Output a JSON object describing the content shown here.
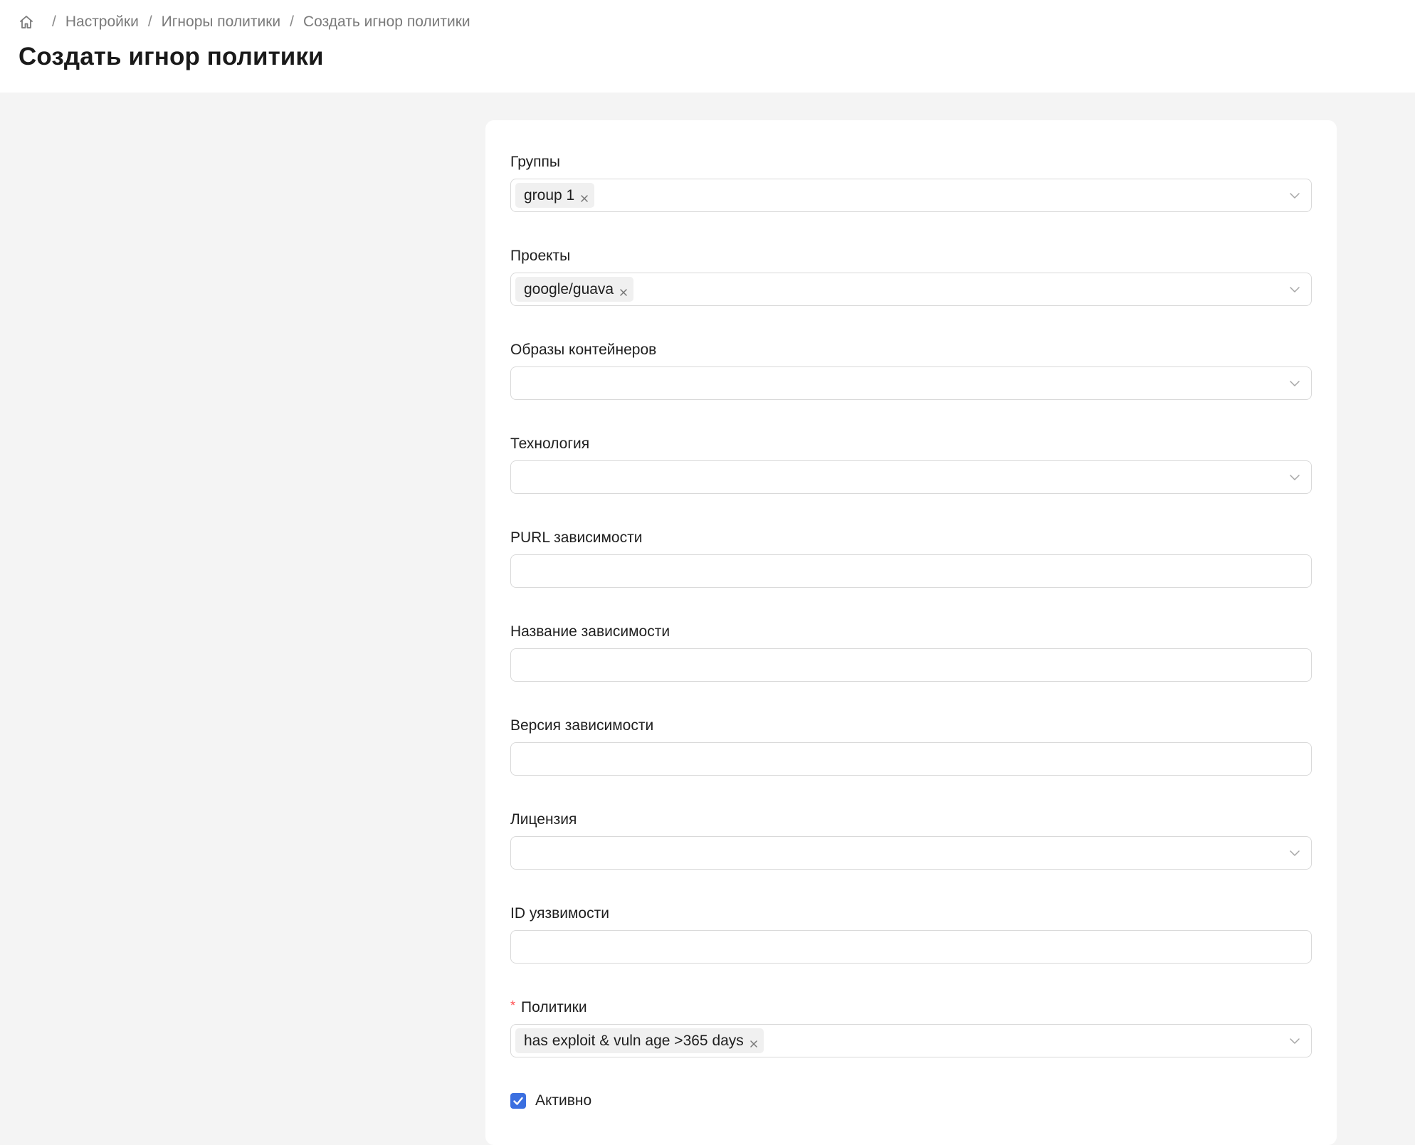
{
  "breadcrumb": {
    "home_icon": "home-icon",
    "items": [
      "Настройки",
      "Игноры политики",
      "Создать игнор политики"
    ]
  },
  "page_title": "Создать игнор политики",
  "form": {
    "groups": {
      "label": "Группы",
      "selected": [
        "group 1"
      ]
    },
    "projects": {
      "label": "Проекты",
      "selected": [
        "google/guava"
      ]
    },
    "container_images": {
      "label": "Образы контейнеров",
      "selected": []
    },
    "technology": {
      "label": "Технология",
      "selected": []
    },
    "dependency_purl": {
      "label": "PURL зависимости",
      "value": ""
    },
    "dependency_name": {
      "label": "Название зависимости",
      "value": ""
    },
    "dependency_version": {
      "label": "Версия зависимости",
      "value": ""
    },
    "license": {
      "label": "Лицензия",
      "selected": []
    },
    "vulnerability_id": {
      "label": "ID уязвимости",
      "value": ""
    },
    "policies": {
      "label": "Политики",
      "required": true,
      "required_mark": "*",
      "selected": [
        "has exploit & vuln age >365 days"
      ]
    },
    "active": {
      "label": "Активно",
      "checked": true
    }
  },
  "colors": {
    "accent": "#3b6fe0",
    "required": "#ff4d4f",
    "background": "#f4f4f4"
  }
}
